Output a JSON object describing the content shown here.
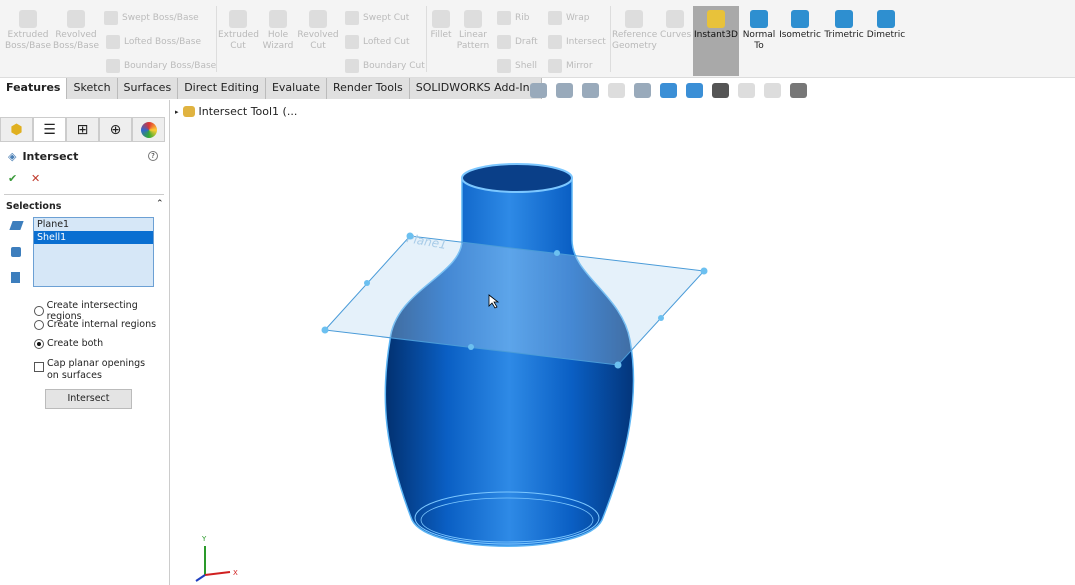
{
  "ribbon": {
    "boss": [
      {
        "label": "Extruded Boss/Base"
      },
      {
        "label": "Revolved Boss/Base"
      }
    ],
    "boss_small": [
      "Swept Boss/Base",
      "Lofted Boss/Base",
      "Boundary Boss/Base"
    ],
    "cut": [
      {
        "label": "Extruded Cut"
      },
      {
        "label": "Hole Wizard"
      },
      {
        "label": "Revolved Cut"
      }
    ],
    "cut_small": [
      "Swept Cut",
      "Lofted Cut",
      "Boundary Cut"
    ],
    "feat": [
      {
        "label": "Fillet"
      },
      {
        "label": "Linear Pattern"
      }
    ],
    "feat_small": [
      "Rib",
      "Draft",
      "Shell"
    ],
    "feat_small2": [
      "Wrap",
      "Intersect",
      "Mirror"
    ],
    "ref": [
      {
        "label": "Reference Geometry"
      },
      {
        "label": "Curves"
      }
    ],
    "instant3d": "Instant3D",
    "views": [
      {
        "label": "Normal To"
      },
      {
        "label": "Isometric"
      },
      {
        "label": "Trimetric"
      },
      {
        "label": "Dimetric"
      }
    ]
  },
  "tabs": [
    "Features",
    "Sketch",
    "Surfaces",
    "Direct Editing",
    "Evaluate",
    "Render Tools",
    "SOLIDWORKS Add-Ins"
  ],
  "tree": {
    "item": "Intersect Tool1 (..."
  },
  "panel": {
    "title": "Intersect",
    "help": "?",
    "ok": "✔",
    "cancel": "✕",
    "section": "Selections",
    "selections": [
      "Plane1",
      "Shell1"
    ],
    "options": [
      "Create intersecting regions",
      "Create internal regions",
      "Create both"
    ],
    "selected_option": "Create both",
    "cap_label": "Cap planar openings on surfaces",
    "cap_checked": false,
    "button": "Intersect"
  },
  "model": {
    "plane_label": "Plane1",
    "color": "#0a5fc4"
  },
  "triad": {
    "x": "X",
    "y": "Y"
  }
}
